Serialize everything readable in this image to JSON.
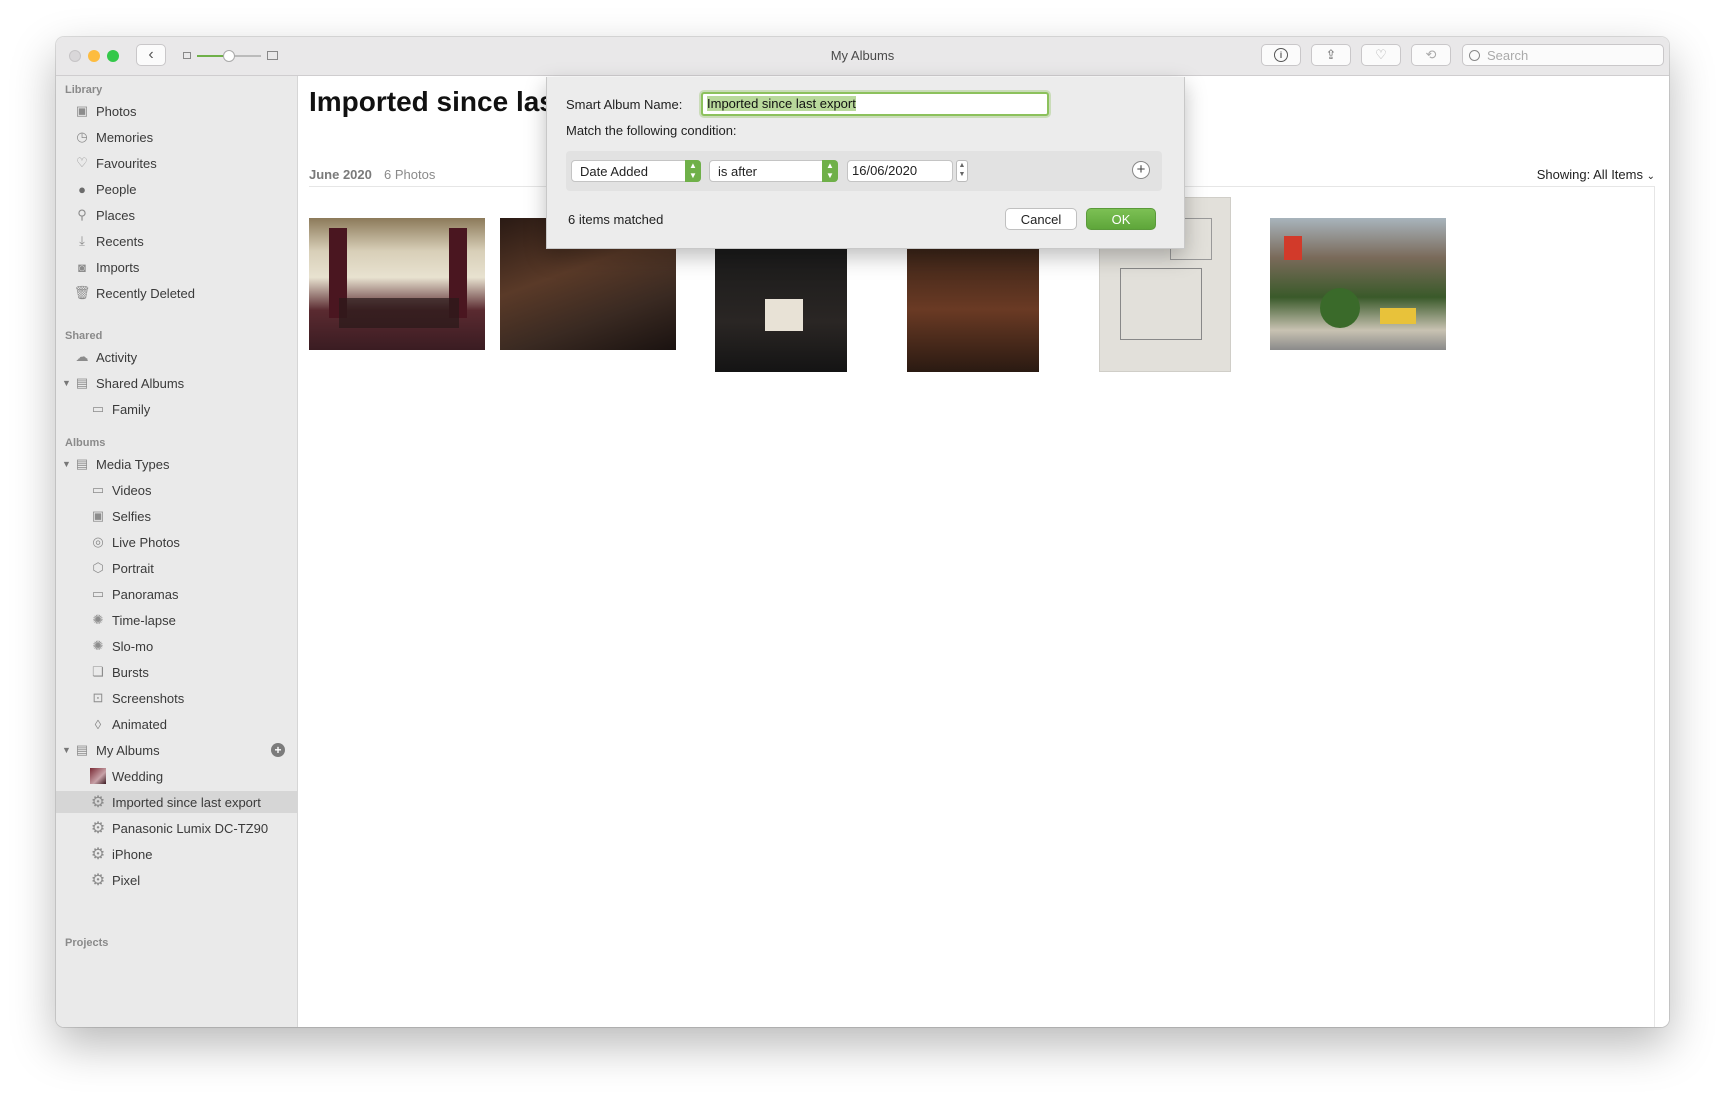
{
  "window": {
    "title": "My Albums"
  },
  "toolbar": {
    "back_icon": "chevron-left-icon",
    "search_placeholder": "Search"
  },
  "sidebar": {
    "library_header": "Library",
    "library": [
      "Photos",
      "Memories",
      "Favourites",
      "People",
      "Places",
      "Recents",
      "Imports",
      "Recently Deleted"
    ],
    "shared_header": "Shared",
    "shared": [
      "Activity",
      "Shared Albums",
      "Family"
    ],
    "albums_header": "Albums",
    "media_types": "Media Types",
    "media": [
      "Videos",
      "Selfies",
      "Live Photos",
      "Portrait",
      "Panoramas",
      "Time-lapse",
      "Slo-mo",
      "Bursts",
      "Screenshots",
      "Animated"
    ],
    "my_albums": "My Albums",
    "albums": [
      "Wedding",
      "Imported since last export",
      "Panasonic Lumix DC-TZ90",
      "iPhone",
      "Pixel"
    ],
    "projects_header": "Projects"
  },
  "main": {
    "title": "Imported since las",
    "date": "June 2020",
    "count": "6 Photos",
    "showing_label": "Showing:",
    "showing_value": "All Items"
  },
  "dialog": {
    "name_label": "Smart Album Name:",
    "name_value": "Imported since last export",
    "match_label": "Match the following condition:",
    "field": "Date Added",
    "operator": "is after",
    "date": "16/06/2020",
    "matched": "6 items matched",
    "cancel": "Cancel",
    "ok": "OK"
  },
  "colors": {
    "accent": "#6fb049",
    "selection": "#d6d6d6"
  }
}
